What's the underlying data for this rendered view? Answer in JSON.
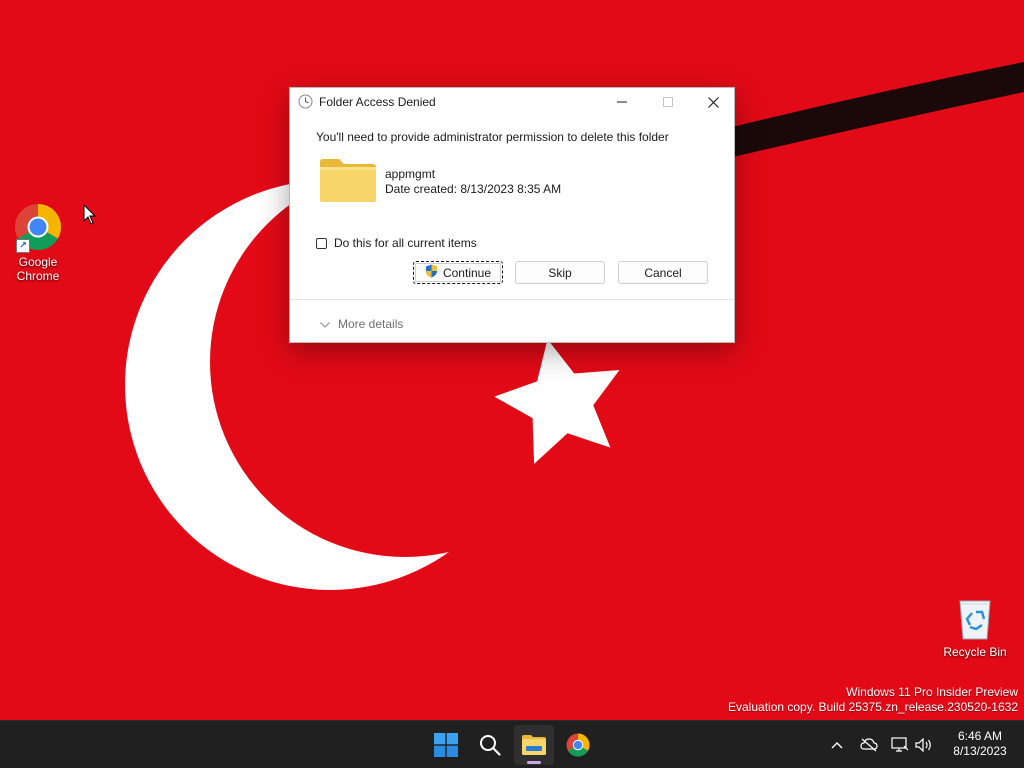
{
  "desktop": {
    "icons": [
      {
        "label": "Google\nChrome",
        "icon": "chrome-icon"
      },
      {
        "label": "Recycle Bin",
        "icon": "recycle-bin-icon"
      }
    ],
    "watermark": {
      "line1": "Windows 11 Pro Insider Preview",
      "line2": "Evaluation copy. Build 25375.zn_release.230520-1632"
    },
    "wallpaper_color": "#e30a17"
  },
  "dialog": {
    "title": "Folder Access Denied",
    "title_icon": "clock-icon",
    "message": "You'll need to provide administrator permission to delete this folder",
    "folder": {
      "name": "appmgmt",
      "date_created": "Date created: 8/13/2023 8:35 AM",
      "icon": "folder-icon"
    },
    "checkbox": {
      "label": "Do this for all current items",
      "checked": false
    },
    "buttons": {
      "continue": "Continue",
      "skip": "Skip",
      "cancel": "Cancel"
    },
    "more_details": "More details"
  },
  "taskbar": {
    "apps": [
      "start-icon",
      "search-icon",
      "file-explorer-icon",
      "chrome-icon"
    ],
    "tray_icons": [
      "chevron-up-icon",
      "network-icon",
      "display-icon",
      "volume-icon"
    ],
    "clock": {
      "time": "6:46 AM",
      "date": "8/13/2023"
    }
  },
  "colors": {
    "accent": "#0067c0",
    "taskbar_bg": "#202020",
    "folder_yellow": "#f8d568"
  }
}
